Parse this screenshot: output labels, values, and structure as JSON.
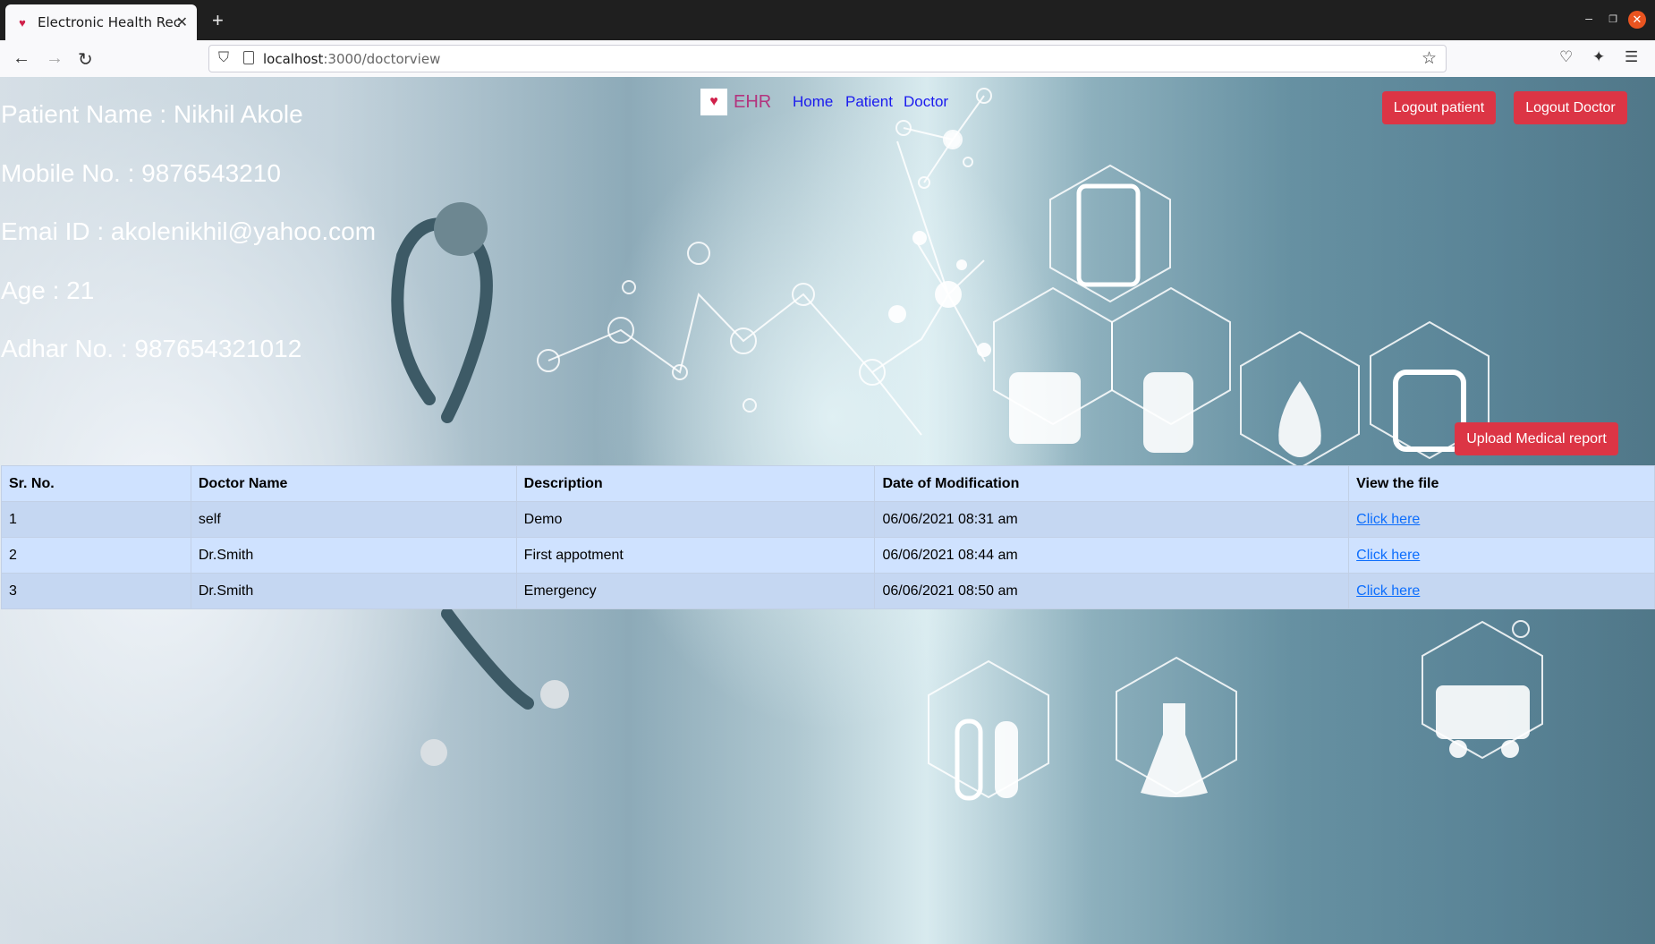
{
  "browser": {
    "tab_title": "Electronic Health Record",
    "url_host": "localhost",
    "url_path": ":3000/doctorview"
  },
  "app": {
    "brand": "EHR",
    "nav": {
      "home": "Home",
      "patient": "Patient",
      "doctor": "Doctor"
    },
    "buttons": {
      "logout_patient": "Logout patient",
      "logout_doctor": "Logout Doctor",
      "upload": "Upload Medical report"
    },
    "accent_color": "#dc3545",
    "link_color": "#1a1aee"
  },
  "patient": {
    "name": "Patient Name : Nikhil Akole",
    "mobile": "Mobile No. : 9876543210",
    "email": "Emai ID : akolenikhil@yahoo.com",
    "age": "Age : 21",
    "adhar": "Adhar No. : 987654321012"
  },
  "table": {
    "headers": [
      "Sr. No.",
      "Doctor Name",
      "Description",
      "Date of Modification",
      "View the file"
    ],
    "rows": [
      {
        "sr": "1",
        "doctor": "self",
        "description": "Demo",
        "date": "06/06/2021 08:31 am",
        "link": "Click here"
      },
      {
        "sr": "2",
        "doctor": "Dr.Smith",
        "description": "First appotment",
        "date": "06/06/2021 08:44 am",
        "link": "Click here"
      },
      {
        "sr": "3",
        "doctor": "Dr.Smith",
        "description": "Emergency",
        "date": "06/06/2021 08:50 am",
        "link": "Click here"
      }
    ]
  }
}
